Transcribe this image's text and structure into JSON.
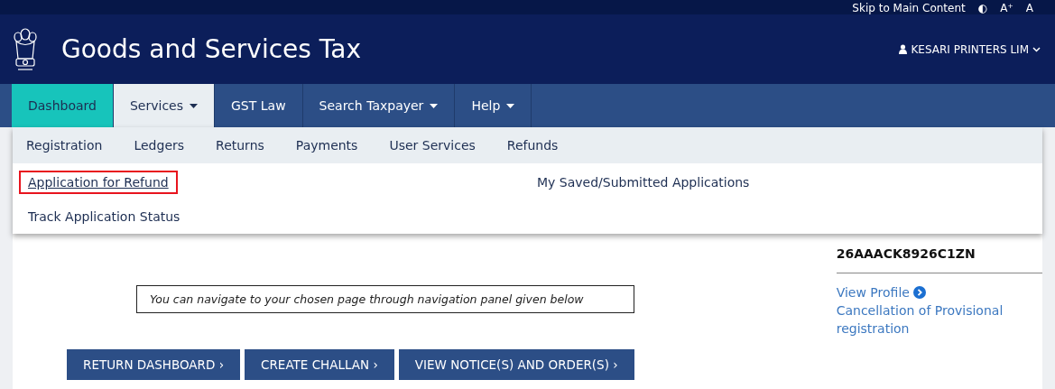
{
  "top_bar": {
    "skip_link": "Skip to Main Content",
    "contrast_toggle": "◐",
    "font_increase": "A⁺",
    "font_default": "A"
  },
  "header": {
    "title": "Goods and Services Tax",
    "user": "KESARI PRINTERS LIM"
  },
  "nav": {
    "tabs": [
      {
        "label": "Dashboard",
        "selected": true,
        "open": false,
        "dropdown": false
      },
      {
        "label": "Services",
        "selected": false,
        "open": true,
        "dropdown": true
      },
      {
        "label": "GST Law",
        "selected": false,
        "open": false,
        "dropdown": false
      },
      {
        "label": "Search Taxpayer",
        "selected": false,
        "open": false,
        "dropdown": true
      },
      {
        "label": "Help",
        "selected": false,
        "open": false,
        "dropdown": true
      }
    ]
  },
  "services_menu": {
    "categories": [
      {
        "label": "Registration"
      },
      {
        "label": "Ledgers"
      },
      {
        "label": "Returns"
      },
      {
        "label": "Payments"
      },
      {
        "label": "User Services"
      },
      {
        "label": "Refunds"
      }
    ],
    "links": [
      {
        "label": "Application for Refund",
        "highlighted": true
      },
      {
        "label": "My Saved/Submitted Applications",
        "highlighted": false
      },
      {
        "label": "Track Application Status",
        "highlighted": false
      }
    ]
  },
  "main": {
    "notice": "You can navigate to your chosen page through navigation panel given below",
    "buttons": [
      "RETURN DASHBOARD ›",
      "CREATE CHALLAN ›",
      "VIEW NOTICE(S) AND ORDER(S) ›"
    ]
  },
  "profile": {
    "gstin": "26AAACK8926C1ZN",
    "links": [
      "View Profile",
      "Cancellation of Provisional registration"
    ]
  }
}
